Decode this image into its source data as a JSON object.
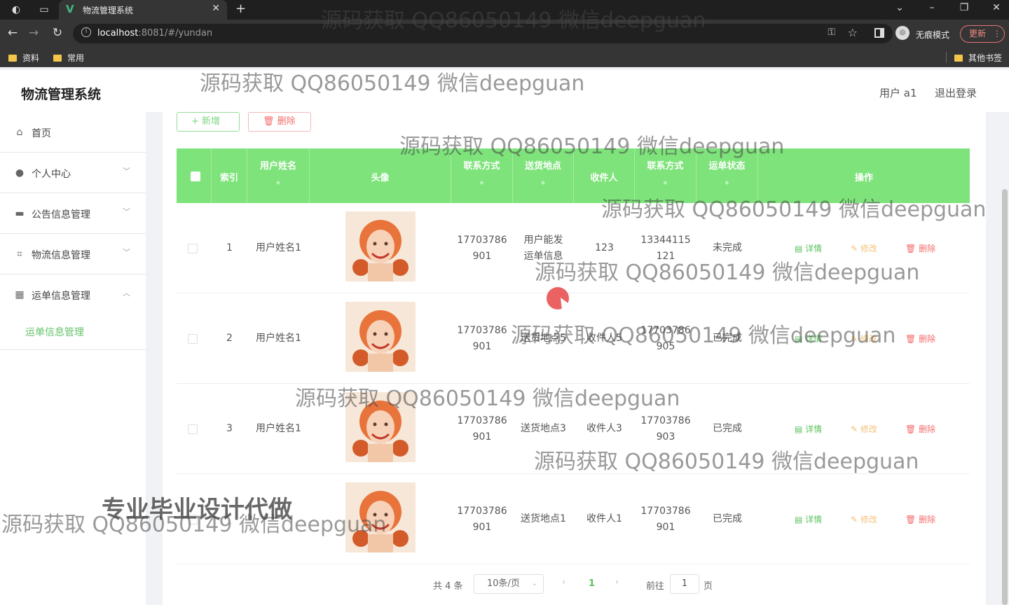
{
  "browser": {
    "tab_title": "物流管理系统",
    "url_host": "localhost",
    "url_rest": ":8081/#/yundan",
    "incognito_label": "无痕模式",
    "update_label": "更新",
    "bookmarks": [
      "资料",
      "常用"
    ],
    "other_bookmarks": "其他书签"
  },
  "header": {
    "brand": "物流管理系统",
    "user": "用户 a1",
    "logout": "退出登录"
  },
  "sidebar": {
    "items": [
      {
        "label": "首页",
        "icon": "home-icon"
      },
      {
        "label": "个人中心",
        "icon": "user-icon"
      },
      {
        "label": "公告信息管理",
        "icon": "monitor-icon"
      },
      {
        "label": "物流信息管理",
        "icon": "crop-icon"
      },
      {
        "label": "运单信息管理",
        "icon": "grid-icon"
      }
    ],
    "sub_item": "运单信息管理"
  },
  "toolbar": {
    "add_label": "新增",
    "delete_label": "删除"
  },
  "table": {
    "headers": [
      "索引",
      "用户姓名",
      "头像",
      "联系方式",
      "送货地点",
      "收件人",
      "联系方式",
      "运单状态",
      "操作"
    ],
    "rows": [
      {
        "index": "1",
        "name": "用户姓名1",
        "phone": "17703786\n901",
        "place": "用户能发\n运单信息",
        "receiver": "123",
        "rphone": "13344115\n121",
        "status": "未完成"
      },
      {
        "index": "2",
        "name": "用户姓名1",
        "phone": "17703786\n901",
        "place": "送货地点5",
        "receiver": "收件人5",
        "rphone": "17703786\n905",
        "status": "已完成"
      },
      {
        "index": "3",
        "name": "用户姓名1",
        "phone": "17703786\n901",
        "place": "送货地点3",
        "receiver": "收件人3",
        "rphone": "17703786\n903",
        "status": "已完成"
      },
      {
        "index": "",
        "name": "",
        "phone": "17703786\n901",
        "place": "送货地点1",
        "receiver": "收件人1",
        "rphone": "17703786\n901",
        "status": "已完成"
      }
    ],
    "actions": {
      "detail": "详情",
      "edit": "修改",
      "delete": "删除"
    }
  },
  "pagination": {
    "total": "共 4 条",
    "page_size": "10条/页",
    "current": "1",
    "goto_label": "前往",
    "goto_value": "1",
    "page_unit": "页"
  },
  "watermark": {
    "text": "源码获取 QQ86050149 微信deepguan",
    "big_text": "专业毕业设计代做"
  },
  "colors": {
    "accent": "#7ee37a",
    "danger": "#f56c6c",
    "warning": "#f5c17b"
  }
}
